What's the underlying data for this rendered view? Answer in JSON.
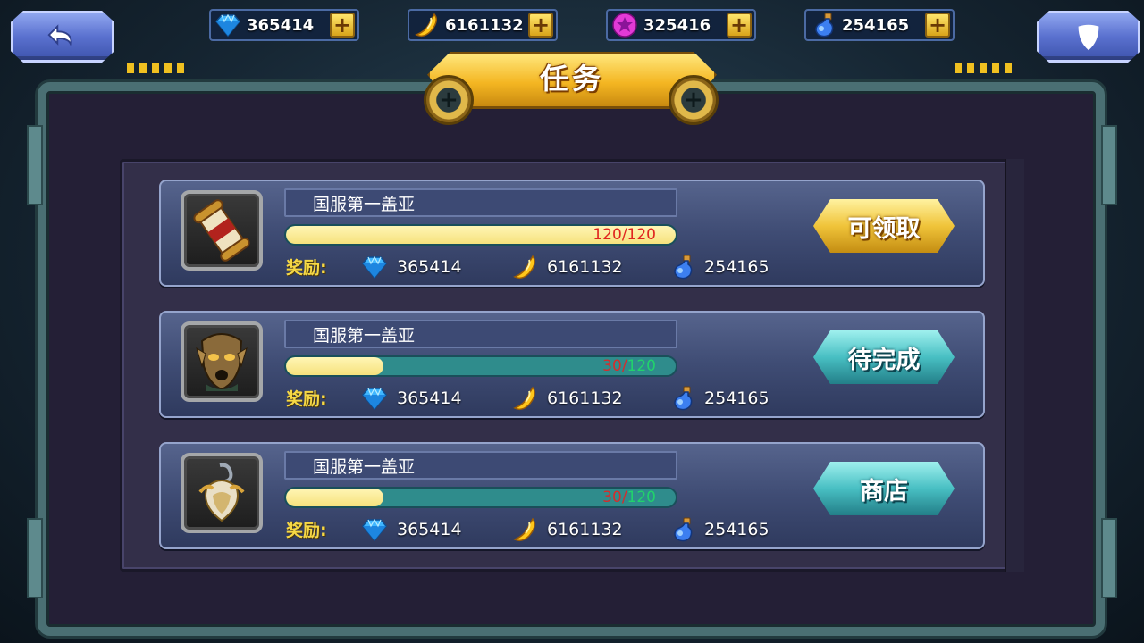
{
  "topbar": {
    "resources": [
      {
        "icon": "diamond-icon",
        "value": "365414"
      },
      {
        "icon": "gold-ingot-icon",
        "value": "6161132"
      },
      {
        "icon": "star-gem-icon",
        "value": "325416"
      },
      {
        "icon": "potion-icon",
        "value": "254165"
      }
    ],
    "plus_symbol": "+"
  },
  "title": "任务",
  "reward_label": "奖励:",
  "tasks": [
    {
      "name": "国服第一盖亚",
      "icon": "scroll-icon",
      "progress": {
        "current": "120",
        "separator": "/",
        "max": "120",
        "fraction": 1.0,
        "complete": true
      },
      "rewards": {
        "diamond": "365414",
        "gold": "6161132",
        "potion": "254165"
      },
      "button": {
        "label": "可领取",
        "style": "gold"
      }
    },
    {
      "name": "国服第一盖亚",
      "icon": "mask-icon",
      "progress": {
        "current": "30",
        "separator": "/",
        "max": "120",
        "fraction": 0.25,
        "complete": false
      },
      "rewards": {
        "diamond": "365414",
        "gold": "6161132",
        "potion": "254165"
      },
      "button": {
        "label": "待完成",
        "style": "teal"
      }
    },
    {
      "name": "国服第一盖亚",
      "icon": "amulet-icon",
      "progress": {
        "current": "30",
        "separator": "/",
        "max": "120",
        "fraction": 0.25,
        "complete": false
      },
      "rewards": {
        "diamond": "365414",
        "gold": "6161132",
        "potion": "254165"
      },
      "button": {
        "label": "商店",
        "style": "teal"
      }
    }
  ],
  "colors": {
    "accent_gold": "#f6d845",
    "progress_fill": "#f6e27d",
    "progress_track": "#2f8c8c",
    "progress_current": "#d62c2c",
    "progress_max": "#21d26c",
    "panel_bg": "#332f49"
  }
}
